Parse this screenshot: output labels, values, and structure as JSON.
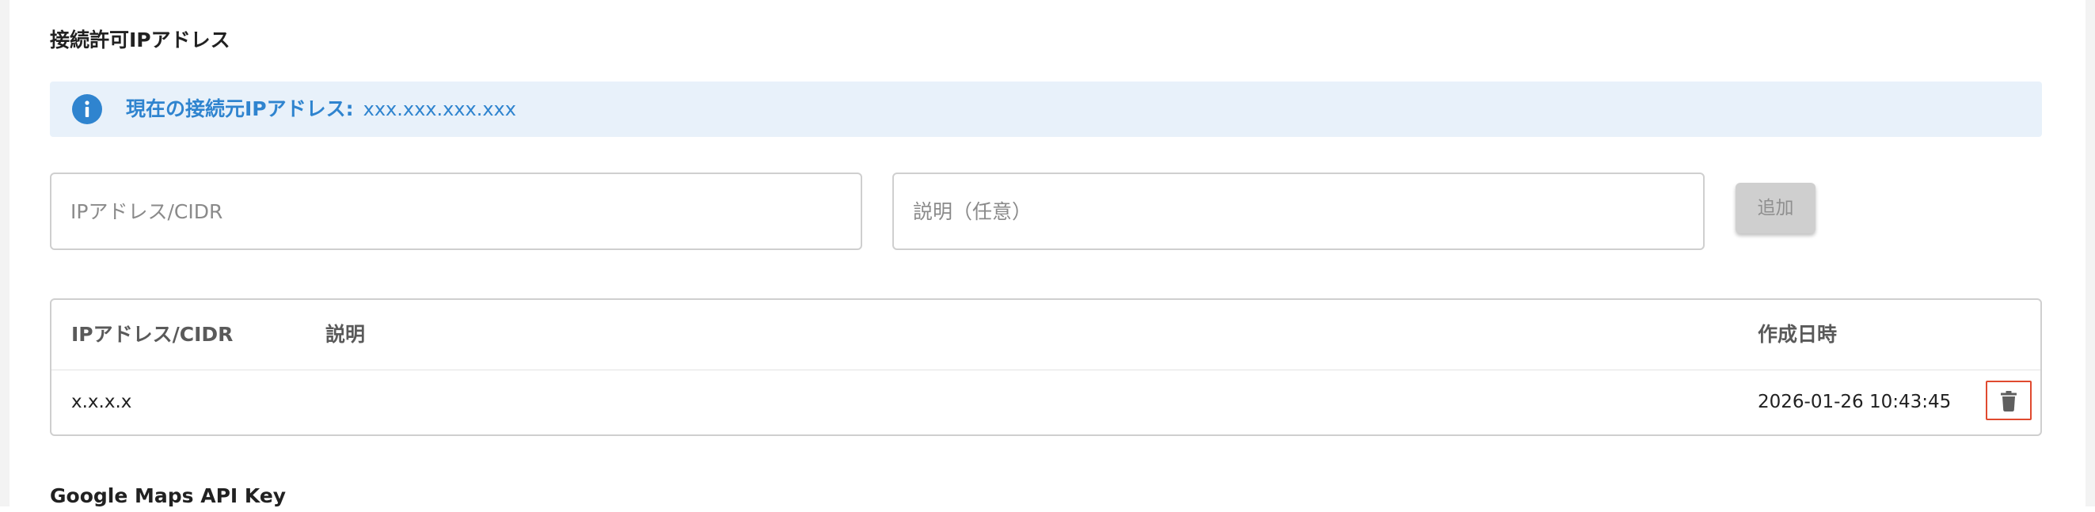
{
  "section": {
    "title": "接続許可IPアドレス"
  },
  "info_banner": {
    "icon": "info-icon",
    "label": "現在の接続元IPアドレス:",
    "value": "xxx.xxx.xxx.xxx",
    "color": "#2f84cf",
    "background": "#e8f1fa"
  },
  "form": {
    "ip_placeholder": "IPアドレス/CIDR",
    "ip_value": "",
    "description_placeholder": "説明（任意）",
    "description_value": "",
    "add_label": "追加"
  },
  "table": {
    "headers": {
      "ip": "IPアドレス/CIDR",
      "description": "説明",
      "created_at": "作成日時"
    },
    "rows": [
      {
        "ip": "x.x.x.x",
        "description": "",
        "created_at": "2026-01-26 10:43:45",
        "delete_icon": "trash-icon"
      }
    ],
    "delete_highlight_color": "#e04a2f"
  },
  "next_section": {
    "title": "Google Maps API Key"
  }
}
